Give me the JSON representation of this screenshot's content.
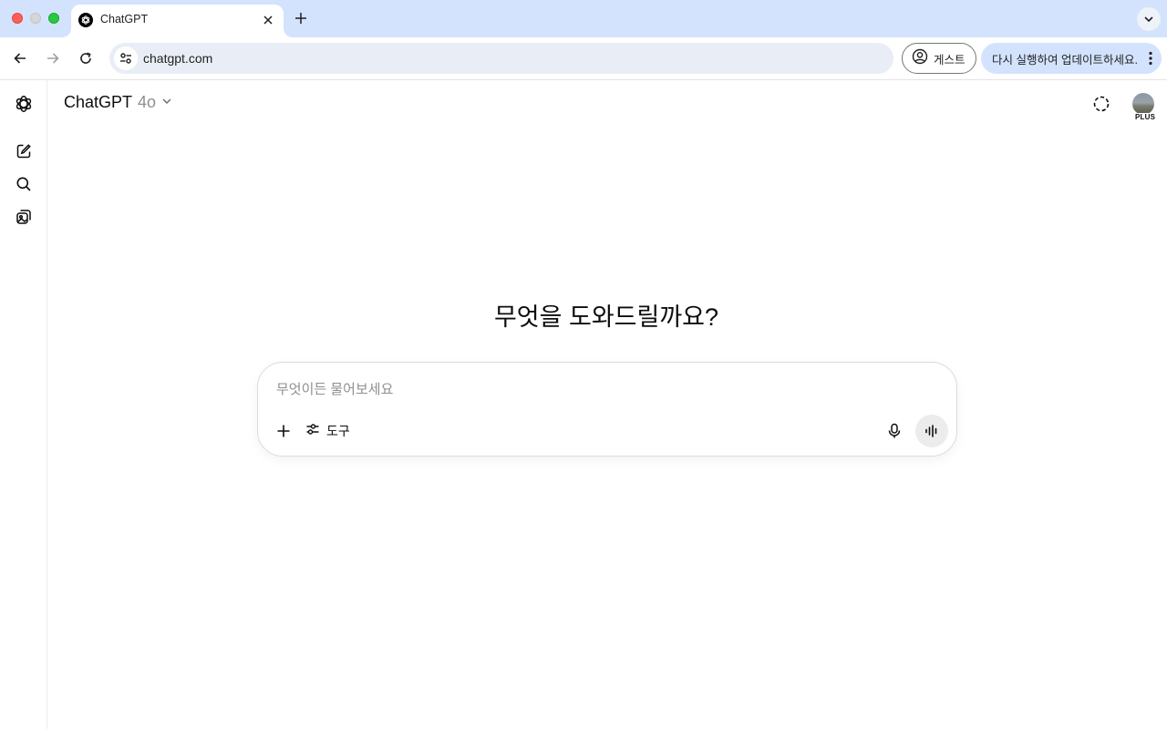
{
  "browser": {
    "tab": {
      "title": "ChatGPT"
    },
    "toolbar": {
      "url": "chatgpt.com",
      "guest_label": "게스트",
      "update_label": "다시 실행하여 업데이트하세요."
    }
  },
  "header": {
    "model_name": "ChatGPT",
    "model_version": "4o",
    "plan_badge": "PLUS"
  },
  "main": {
    "headline": "무엇을 도와드릴까요?",
    "composer": {
      "placeholder": "무엇이든 물어보세요",
      "value": "",
      "tools_label": "도구"
    }
  },
  "icons": {
    "sidebar": [
      "chatgpt-logo-icon",
      "new-chat-icon",
      "search-icon",
      "library-icon"
    ],
    "header": [
      "temporary-chat-icon",
      "avatar"
    ],
    "composer": [
      "plus-icon",
      "tools-sliders-icon",
      "microphone-icon",
      "voice-mode-icon"
    ]
  },
  "colors": {
    "tabstrip": "#d3e3fd",
    "omnibox": "#e9eef6",
    "update_button": "#d3e3fd",
    "voice_button": "#ececec"
  }
}
